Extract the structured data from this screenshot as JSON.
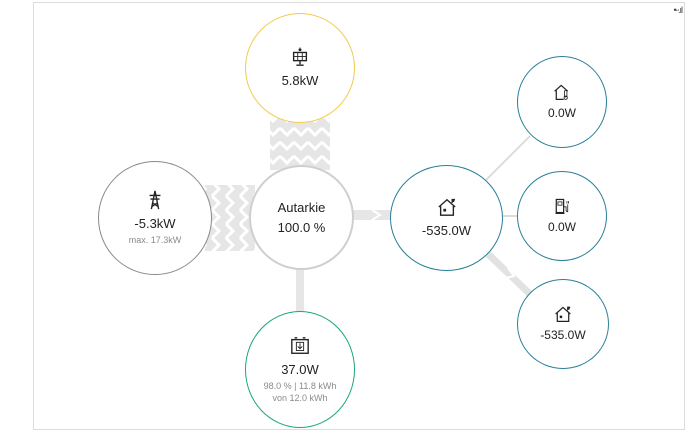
{
  "colors": {
    "solar": "#f2cc4d",
    "grid": "#8a8a8a",
    "battery": "#1aa57c",
    "consumer": "#2a7f9a",
    "flow": "#d9d9d9"
  },
  "status": {
    "signal_icon": "signal-icon"
  },
  "center": {
    "title": "Autarkie",
    "value": "100.0 %"
  },
  "solar": {
    "icon": "solar-panel-icon",
    "value": "5.8kW"
  },
  "grid": {
    "icon": "power-tower-icon",
    "value": "-5.3kW",
    "max": "max. 17.3kW"
  },
  "battery": {
    "icon": "battery-icon",
    "value": "37.0W",
    "detail1": "98.0 % | 11.8 kWh",
    "detail2": "von 12.0 kWh"
  },
  "house": {
    "icon": "house-icon",
    "value": "-535.0W"
  },
  "consumers": [
    {
      "icon": "heat-pump-icon",
      "value": "0.0W"
    },
    {
      "icon": "ev-charger-icon",
      "value": "0.0W"
    },
    {
      "icon": "house-icon",
      "value": "-535.0W"
    }
  ]
}
